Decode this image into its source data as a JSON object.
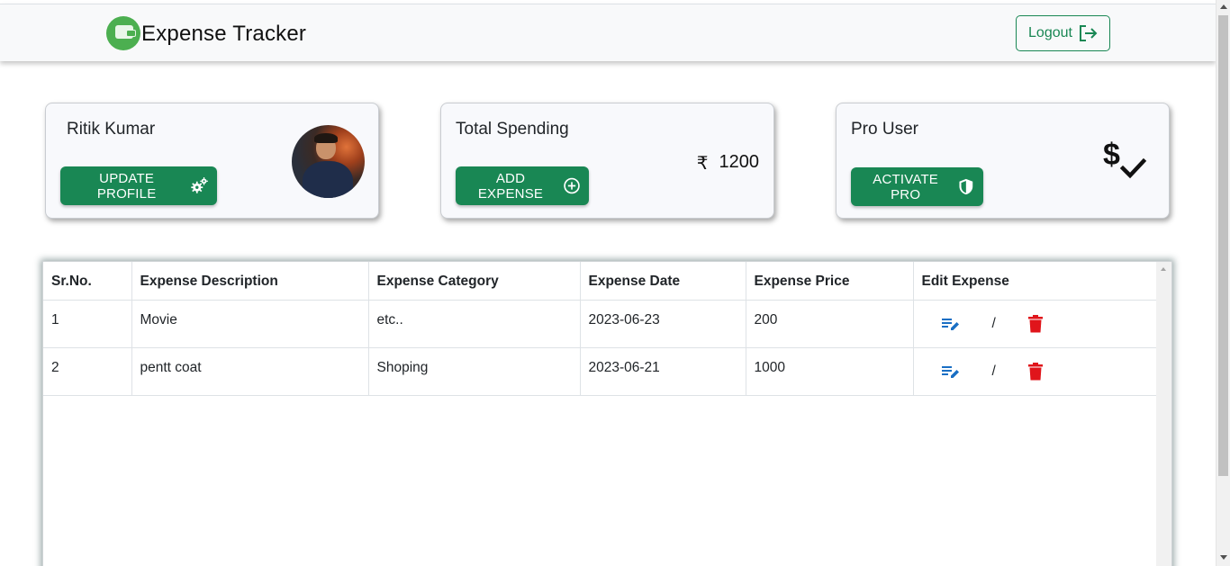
{
  "navbar": {
    "brand_title": "Expense Tracker",
    "logout_label": "Logout"
  },
  "profile_card": {
    "name": "Ritik Kumar",
    "button_label": "UPDATE PROFILE"
  },
  "spending_card": {
    "title": "Total Spending",
    "currency": "₹",
    "amount": "1200",
    "button_label": "ADD EXPENSE"
  },
  "pro_card": {
    "title": "Pro User",
    "button_label": "ACTIVATE PRO"
  },
  "table": {
    "headers": [
      "Sr.No.",
      "Expense Description",
      "Expense Category",
      "Expense Date",
      "Expense Price",
      "Edit Expense"
    ],
    "rows": [
      {
        "sr": "1",
        "description": "Movie",
        "category": "etc..",
        "date": "2023-06-23",
        "price": "200",
        "separator": "/"
      },
      {
        "sr": "2",
        "description": "pentt coat",
        "category": "Shoping",
        "date": "2023-06-21",
        "price": "1000",
        "separator": "/"
      }
    ]
  },
  "colors": {
    "primary_green": "#198754",
    "edit_blue": "#1a6fc4",
    "delete_red": "#e0151b"
  },
  "icons": {
    "brand": "wallet-icon",
    "logout": "box-arrow-right-icon",
    "update_profile": "gears-icon",
    "add_expense": "plus-circle-icon",
    "activate_pro": "shield-icon",
    "pro_badge": "dollar-check-icon",
    "edit": "edit-note-icon",
    "delete": "trash-icon"
  }
}
